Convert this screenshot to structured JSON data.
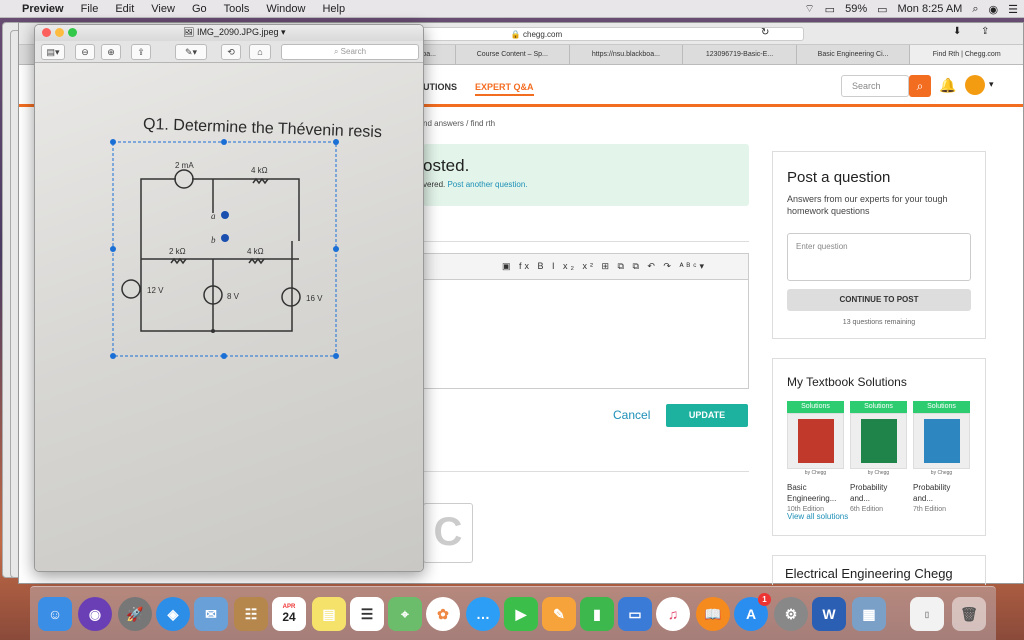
{
  "menubar": {
    "apple": "",
    "app": "Preview",
    "items": [
      "File",
      "Edit",
      "View",
      "Go",
      "Tools",
      "Window",
      "Help"
    ],
    "battery": "59%",
    "clock": "Mon 8:25 AM"
  },
  "browser": {
    "url": "chegg.com",
    "tabs": [
      "kboa...",
      "Course Content – Sp...",
      "https://nsu.blackboa...",
      "123096719-Basic-E...",
      "Basic Engineering Ci...",
      "Find Rth | Chegg.com"
    ],
    "nav_left": "UTIONS",
    "nav_active": "EXPERT Q&A",
    "search_placeholder": "Search",
    "breadcrumb": "nd answers / find rth",
    "posted_title": "osted.",
    "posted_sub": "vered.",
    "posted_link": "Post another question.",
    "cancel": "Cancel",
    "update": "UPDATE",
    "big_c": "C"
  },
  "post_card": {
    "title": "Post a question",
    "subtitle": "Answers from our experts for your tough homework questions",
    "input_placeholder": "Enter question",
    "continue": "CONTINUE TO POST",
    "remaining": "13 questions remaining"
  },
  "textbook_card": {
    "title": "My Textbook Solutions",
    "books": [
      {
        "tag": "Solutions",
        "by": "by Chegg",
        "title": "Basic Engineering...",
        "edition": "10th Edition",
        "color": "#c0392b"
      },
      {
        "tag": "Solutions",
        "by": "by Chegg",
        "title": "Probability and...",
        "edition": "6th Edition",
        "color": "#1e8449"
      },
      {
        "tag": "Solutions",
        "by": "by Chegg",
        "title": "Probability and...",
        "edition": "7th Edition",
        "color": "#2e86c1"
      }
    ],
    "view_all": "View all solutions"
  },
  "ee_card": {
    "title": "Electrical Engineering Chegg"
  },
  "preview": {
    "filename": "IMG_2090.JPG.jpeg",
    "search_placeholder": "Search",
    "question": "Q1. Determine the Thévenin resis"
  },
  "circuit": {
    "current_source": "2 mA",
    "r1": "4 kΩ",
    "r2": "2 kΩ",
    "r3": "4 kΩ",
    "node_a": "a",
    "node_b": "b",
    "v1": "12 V",
    "v2": "8 V",
    "v3": "16 V"
  },
  "dock": {
    "calendar_month": "APR",
    "calendar_day": "24",
    "badge": "1"
  }
}
